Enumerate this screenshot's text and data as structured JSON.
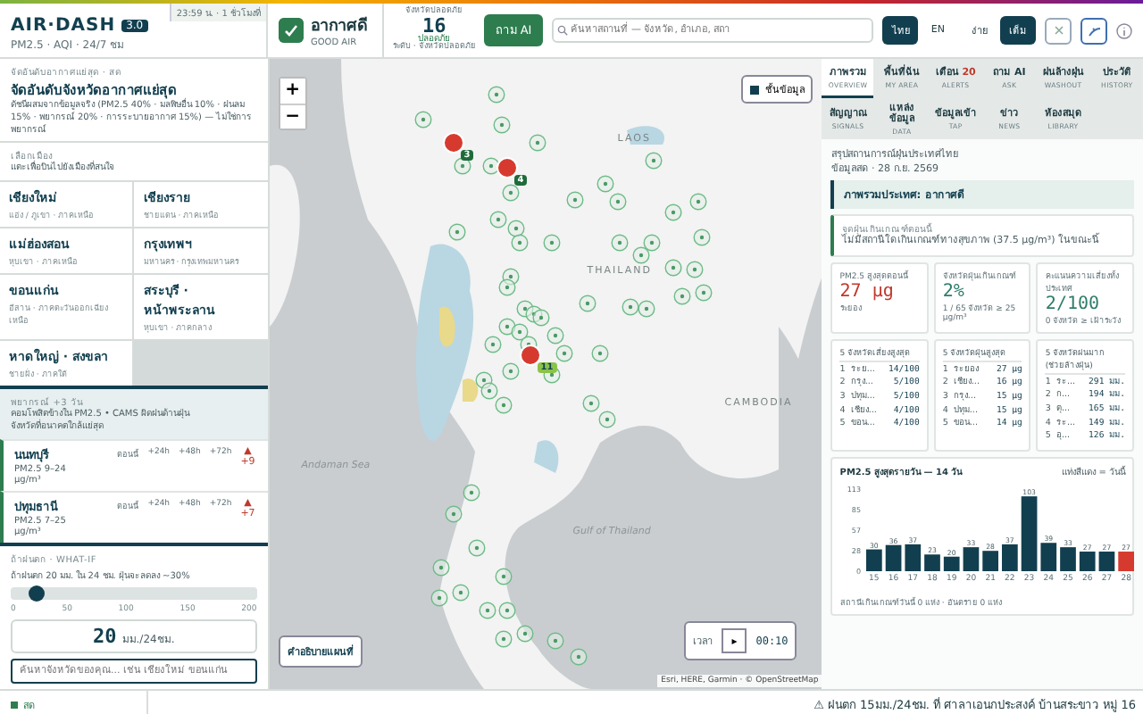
{
  "header": {
    "logo": "AIR·DASH",
    "version": "3.0",
    "tagline": "PM2.5 · AQI · 24/7 ชม",
    "clock": "23:59 น. · 1 ชั่วโมงที่",
    "status": {
      "label": "อากาศดี",
      "sub": "GOOD AIR"
    },
    "provinces": {
      "caption": "จังหวัดปลอดภัย",
      "count": "16",
      "label": "ปลอดภัย",
      "sub": "ระดับ · จังหวัดปลอดภัย"
    },
    "ask_button": "ถาม AI",
    "search": {
      "placeholder": "ค้นหาสถานที่ — จังหวัด, อำเภอ, สถา"
    },
    "languages": [
      {
        "label": "ไทย",
        "selected": true
      },
      {
        "label": "EN",
        "selected": false
      }
    ],
    "modes": [
      {
        "label": "ง่าย",
        "selected": false
      },
      {
        "label": "เต็ม",
        "selected": true
      }
    ]
  },
  "ranking": {
    "eyebrow": "จัดอันดับอากาศแย่สุด · สด",
    "title": "จัดอันดับจังหวัดอากาศแย่สุด",
    "description": "ดัชนีผสมจากข้อมูลจริง (PM2.5 40% · มลพิษอื่น 10% · ฝนลม 15% · พยากรณ์ 20% · การระบายอากาศ 15%) — ไม่ใช่การพยากรณ์"
  },
  "cities": {
    "eyebrow": "เลือกเมือง",
    "hint": "แตะเพื่อบินไปยังเมืองที่สนใจ",
    "items": [
      {
        "name": "เชียงใหม่",
        "sub": "แอ่ง / ภูเขา · ภาคเหนือ"
      },
      {
        "name": "เชียงราย",
        "sub": "ชายแดน · ภาคเหนือ"
      },
      {
        "name": "แม่ฮ่องสอน",
        "sub": "หุบเขา · ภาคเหนือ"
      },
      {
        "name": "กรุงเทพฯ",
        "sub": "มหานคร · กรุงเทพมหานคร"
      },
      {
        "name": "ขอนแก่น",
        "sub": "อีสาน · ภาคตะวันออกเฉียงเหนือ"
      },
      {
        "name": "สระบุรี · หน้าพระลาน",
        "sub": "หุบเขา · ภาคกลาง"
      },
      {
        "name": "หาดใหญ่ · สงขลา",
        "sub": "ชายฝั่ง · ภาคใต้"
      }
    ]
  },
  "forecast": {
    "title": "พยากรณ์ +3 วัน",
    "description": "คอมโพสิตข้างใน PM2.5 • CAMS ผิดฝนด้านฝุ่น",
    "note": "จังหวัดที่อนาคตใกล้แย่สุด",
    "rows": [
      {
        "name": "นนทบุรี",
        "range": "PM2.5 9–24",
        "unit": "µg/m³",
        "columns": [
          "ตอนนี้",
          "+24h",
          "+48h",
          "+72h"
        ],
        "arrow": "▲",
        "change": "+9"
      },
      {
        "name": "ปทุมธานี",
        "range": "PM2.5 7–25",
        "unit": "µg/m³",
        "columns": [
          "ตอนนี้",
          "+24h",
          "+48h",
          "+72h"
        ],
        "arrow": "▲",
        "change": "+7"
      }
    ]
  },
  "what_if": {
    "eyebrow": "ถ้าฝนตก · WHAT-IF",
    "description": "ถ้าฝนตก 20 มม. ใน 24 ชม. ฝุ่นจะลดลง ~30%",
    "slider": {
      "level": 0.1,
      "ticks": [
        "0",
        "50",
        "100",
        "150",
        "200"
      ]
    },
    "value": "20",
    "unit": "มม./24ชม.",
    "search": {
      "placeholder": "ค้นหาจังหวัดของคุณ... เช่น เชียงใหม่ ขอนแก่น"
    }
  },
  "map": {
    "zoom_in": "+",
    "zoom_out": "−",
    "layers_button": "ชั้นข้อมูล",
    "legend_button": "คำอธิบายแผนที่",
    "labels": [
      {
        "kind": "country",
        "text": "LAOS"
      },
      {
        "kind": "country",
        "text": "THAILAND"
      },
      {
        "kind": "country",
        "text": "CAMBODIA"
      },
      {
        "kind": "sea",
        "text": "Andaman Sea"
      },
      {
        "kind": "sea",
        "text": "Gulf of Thailand"
      }
    ],
    "alerts": [
      {
        "count": "3"
      },
      {
        "count": "4"
      },
      {
        "count": "11"
      }
    ],
    "time": {
      "label": "เวลา",
      "play": "▸",
      "clock": "00:10"
    },
    "attribution": "Esri, HERE, Garmin · © OpenStreetMap"
  },
  "panel": {
    "tabs": [
      {
        "label": "ภาพรวม",
        "sub": "OVERVIEW",
        "selected": true
      },
      {
        "label": "พื้นที่ฉัน",
        "sub": "MY AREA",
        "selected": false
      },
      {
        "label": "เตือน",
        "badge": "20",
        "sub": "ALERTS",
        "selected": false
      },
      {
        "label": "ถาม AI",
        "sub": "ASK",
        "selected": false
      },
      {
        "label": "ฝนล้างฝุ่น",
        "sub": "WASHOUT",
        "selected": false
      },
      {
        "label": "ประวัติ",
        "sub": "HISTORY",
        "selected": false
      },
      {
        "label": "สัญญาณ",
        "sub": "SIGNALS",
        "selected": false
      },
      {
        "label": "แหล่งข้อมูล",
        "sub": "DATA",
        "selected": false
      },
      {
        "label": "ข้อมูลเข้า",
        "sub": "TAP",
        "selected": false
      },
      {
        "label": "ข่าว",
        "sub": "NEWS",
        "selected": false
      },
      {
        "label": "ห้องสมุด",
        "sub": "LIBRARY",
        "selected": false
      }
    ],
    "title": "สรุปสถานการณ์ฝุ่นประเทศไทย",
    "date": "ข้อมูลสด · 28 ก.ย. 2569",
    "banner": "ภาพรวมประเทศ: อากาศดี",
    "hotspot": {
      "eyebrow": "จุดฝุ่นเกินเกณฑ์ตอนนี้",
      "text": "ไม่มีสถานีใดเกินเกณฑ์ทางสุขภาพ (37.5 µg/m³) ในขณะนี้"
    },
    "stats": [
      {
        "label": "PM2.5 สูงสุดตอนนี้",
        "value": "27 µg",
        "sub": "ระยอง",
        "kind": "alert"
      },
      {
        "label": "จังหวัดฝุ่นเกินเกณฑ์",
        "value": "2%",
        "sub": "1 / 65 จังหวัด ≥ 25 µg/m³",
        "kind": "ok"
      },
      {
        "label": "คะแนนความเสี่ยงทั้งประเทศ",
        "value": "2/100",
        "sub": "0 จังหวัด ≥ เฝ้าระวัง",
        "kind": "ok"
      }
    ],
    "lists": [
      {
        "title": "5 จังหวัดเสี่ยงสูงสุด",
        "rows": [
          {
            "rank": "1",
            "name": "ระย...",
            "value": "14/100"
          },
          {
            "rank": "2",
            "name": "กรุง...",
            "value": "5/100"
          },
          {
            "rank": "3",
            "name": "ปทุม...",
            "value": "5/100"
          },
          {
            "rank": "4",
            "name": "เชียง...",
            "value": "4/100"
          },
          {
            "rank": "5",
            "name": "ขอน...",
            "value": "4/100"
          }
        ]
      },
      {
        "title": "5 จังหวัดฝุ่นสูงสุด",
        "rows": [
          {
            "rank": "1",
            "name": "ระยอง",
            "value": "27 µg"
          },
          {
            "rank": "2",
            "name": "เชียง...",
            "value": "16 µg"
          },
          {
            "rank": "3",
            "name": "กรุง...",
            "value": "15 µg"
          },
          {
            "rank": "4",
            "name": "ปทุม...",
            "value": "15 µg"
          },
          {
            "rank": "5",
            "name": "ขอน...",
            "value": "14 µg"
          }
        ]
      },
      {
        "title": "5 จังหวัดฝนมาก (ช่วยล้างฝุ่น)",
        "rows": [
          {
            "rank": "1",
            "name": "ระ...",
            "value": "291 มม."
          },
          {
            "rank": "2",
            "name": "ก...",
            "value": "194 มม."
          },
          {
            "rank": "3",
            "name": "ตุ...",
            "value": "165 มม."
          },
          {
            "rank": "4",
            "name": "ระ...",
            "value": "149 มม."
          },
          {
            "rank": "5",
            "name": "อุ...",
            "value": "126 มม."
          }
        ]
      }
    ],
    "chart": {
      "title": "PM2.5 สูงสุดรายวัน — 14 วัน",
      "legend": "แท่งสีแดง = วันนี้",
      "footer": "สถานีเกินเกณฑ์วันนี้ 0 แห่ง · อันตราย 0 แห่ง",
      "chart_data": {
        "type": "bar",
        "categories": [
          "15",
          "16",
          "17",
          "18",
          "19",
          "20",
          "21",
          "22",
          "23",
          "24",
          "25",
          "26",
          "27",
          "28"
        ],
        "series": [
          {
            "color": "#123f4f",
            "values": [
              30,
              36,
              37,
              23,
              20,
              33,
              28,
              37,
              103,
              39,
              33,
              27,
              27,
              null
            ]
          },
          {
            "color": "#d63a2f",
            "values": [
              null,
              null,
              null,
              null,
              null,
              null,
              null,
              null,
              null,
              null,
              null,
              null,
              null,
              27
            ]
          }
        ],
        "yticks": [
          0,
          28,
          57,
          85,
          113
        ],
        "ylim": [
          0,
          113
        ],
        "data_labels": true
      }
    }
  },
  "footer": {
    "live": "สด",
    "ticker": "⚠ ฝนตก 15มม./24ชม. ที่ ศาลาเอนกประสงค์ บ้านสระขาว หมู่ 16"
  }
}
